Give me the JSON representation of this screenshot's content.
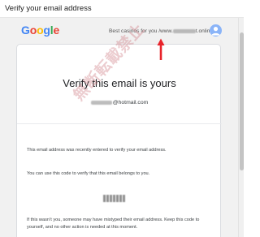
{
  "window": {
    "subject": "Verify your email address"
  },
  "header": {
    "logo_letters": [
      {
        "char": "G",
        "color": "#4285F4"
      },
      {
        "char": "o",
        "color": "#EA4335"
      },
      {
        "char": "o",
        "color": "#FBBC05"
      },
      {
        "char": "g",
        "color": "#4285F4"
      },
      {
        "char": "l",
        "color": "#34A853"
      },
      {
        "char": "e",
        "color": "#EA4335"
      }
    ],
    "brand_prefix": "Best casinos for you /www.",
    "brand_suffix": "t.online?",
    "avatar_icon": "person-icon"
  },
  "annotation": {
    "arrow_color": "#e8232a",
    "watermark": "無断転載禁止"
  },
  "card": {
    "title": "Verify this email is yours",
    "email_suffix": "@hotmail.com",
    "para1": "This email address was recently entered to verify your email address.",
    "para2": "You can use this code to verify that this email belongs to you.",
    "para3": "If this wasn’t you, someone may have mistyped their email address. Keep this code to yourself, and no other action is needed at this moment."
  },
  "colors": {
    "background": "#f1f1f1",
    "card": "#ffffff",
    "text": "#202124"
  }
}
